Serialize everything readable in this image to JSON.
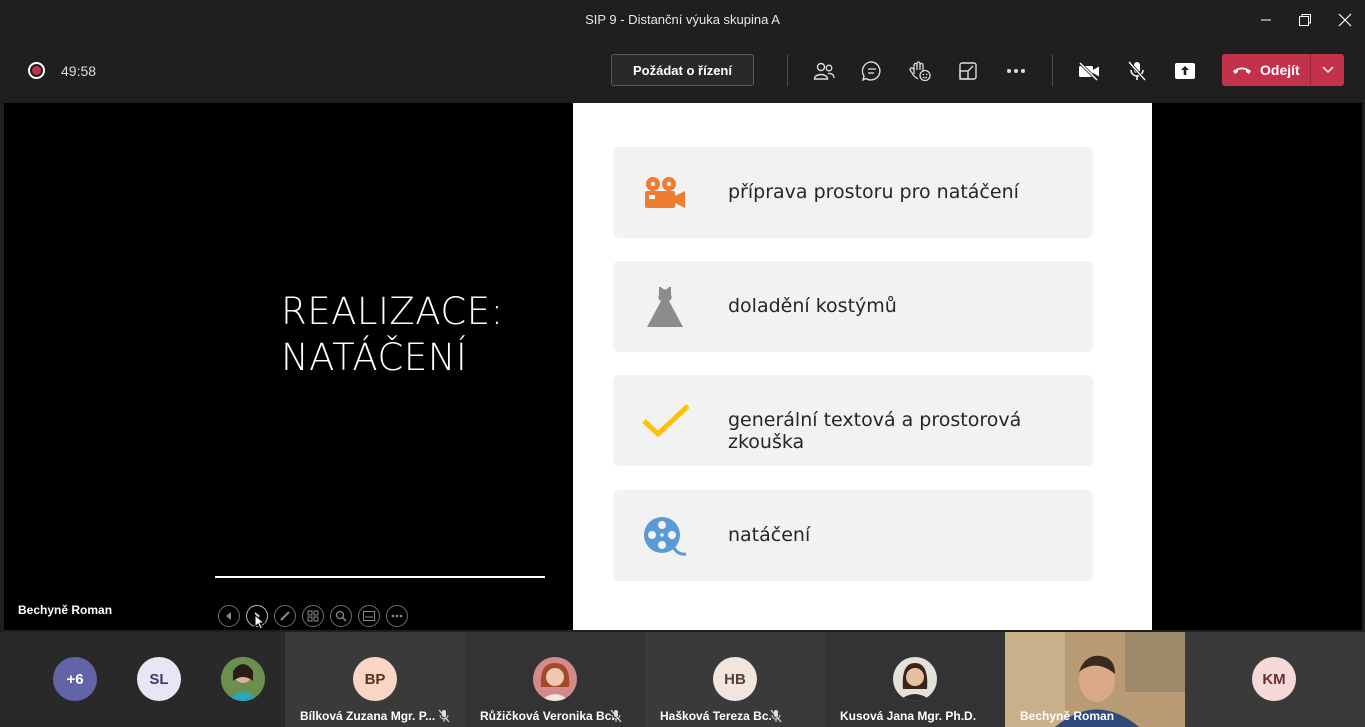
{
  "window": {
    "title": "SIP 9 - Distanční výuka skupina A"
  },
  "toolbar": {
    "timer": "49:58",
    "request_control_label": "Požádat o řízení",
    "leave_label": "Odejít",
    "icons": [
      "participants-icon",
      "chat-icon",
      "reactions-icon",
      "share-tray-icon",
      "more-icon",
      "camera-off-icon",
      "mic-off-icon",
      "share-screen-icon"
    ]
  },
  "stage": {
    "presenter_name": "Bechyně Roman",
    "slide": {
      "title_line1": "REALIZACE:",
      "title_line2": "NATÁČENÍ",
      "items": [
        {
          "label": "příprava prostoru pro natáčení",
          "icon": "movie-camera-icon",
          "color": "#ed7d31"
        },
        {
          "label": "doladění kostýmů",
          "icon": "dress-icon",
          "color": "#8c8c8c"
        },
        {
          "label": "generální textová a prostorová zkouška",
          "icon": "checkmark-icon",
          "color": "#ffc000"
        },
        {
          "label": "natáčení",
          "icon": "film-reel-icon",
          "color": "#5b9bd5"
        }
      ]
    }
  },
  "participants": {
    "overflow": "+6",
    "tiles": [
      {
        "initials": "SL",
        "name": ""
      },
      {
        "initials": "",
        "name": ""
      },
      {
        "initials": "BP",
        "name": "Bílková Zuzana Mgr. P...",
        "muted": true
      },
      {
        "initials": "",
        "name": "Růžičková Veronika Bc.",
        "muted": true
      },
      {
        "initials": "HB",
        "name": "Hašková Tereza Bc.",
        "muted": true
      },
      {
        "initials": "",
        "name": "Kusová Jana Mgr. Ph.D.",
        "muted": false
      },
      {
        "initials": "",
        "name": "Bechyně Roman",
        "muted": false
      },
      {
        "initials": "KM",
        "name": ""
      }
    ]
  }
}
